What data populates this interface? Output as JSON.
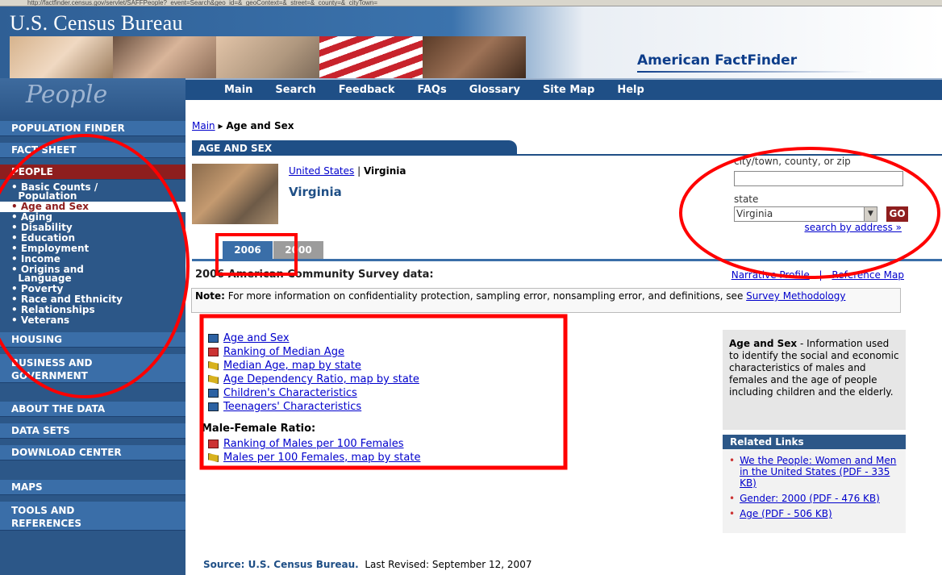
{
  "browser": {
    "address": "http://factfinder.census.gov/servlet/SAFFPeople?_event=Search&geo_id=&_geoContext=&_street=&_county=&_cityTown="
  },
  "header": {
    "title": "U.S. Census Bureau",
    "product": "American FactFinder",
    "people_script": "People"
  },
  "mainnav": [
    "Main",
    "Search",
    "Feedback",
    "FAQs",
    "Glossary",
    "Site Map",
    "Help"
  ],
  "sidebar": {
    "population_finder": "POPULATION FINDER",
    "fact_sheet": "FACT SHEET",
    "people": "PEOPLE",
    "people_items": [
      "• Basic Counts /\n  Population",
      "• Age and Sex",
      "• Aging",
      "• Disability",
      "• Education",
      "• Employment",
      "• Income",
      "• Origins and\n  Language",
      "• Poverty",
      "• Race and Ethnicity",
      "• Relationships",
      "• Veterans"
    ],
    "housing": "HOUSING",
    "business": "BUSINESS AND\nGOVERNMENT",
    "about": "ABOUT THE DATA",
    "data_sets": "DATA SETS",
    "download": "DOWNLOAD CENTER",
    "maps": "MAPS",
    "tools": "TOOLS AND\nREFERENCES"
  },
  "breadcrumb": {
    "main": "Main",
    "sep": "▸",
    "current": "Age and Sex"
  },
  "section_title": "AGE AND SEX",
  "geo": {
    "crumb_link": "United States",
    "crumb_sep": " | ",
    "crumb_current": "Virginia",
    "name": "Virginia"
  },
  "search": {
    "ctzip_label": "city/town, county, or zip",
    "ctzip_value": "",
    "state_label": "state",
    "state_value": "Virginia",
    "go": "GO",
    "by_address": "search by address »"
  },
  "year_tabs": [
    "2006",
    "2000"
  ],
  "acs": {
    "title": "2006 American Community Survey data:",
    "narrative": "Narrative Profile",
    "sep": "|",
    "reference": "Reference Map"
  },
  "note": {
    "label": "Note:",
    "text": " For more information on confidentiality protection, sampling error, nonsampling error, and definitions, see ",
    "link": "Survey Methodology"
  },
  "links": [
    {
      "icon": "table-icon",
      "text": "Age and Sex"
    },
    {
      "icon": "ranking-icon",
      "text": "Ranking of Median Age"
    },
    {
      "icon": "map-icon",
      "text": "Median Age, map by state"
    },
    {
      "icon": "map-icon",
      "text": "Age Dependency Ratio, map by state"
    },
    {
      "icon": "table-icon",
      "text": "Children's Characteristics"
    },
    {
      "icon": "table-icon",
      "text": "Teenagers' Characteristics"
    }
  ],
  "mf_heading": "Male-Female Ratio:",
  "links2": [
    {
      "icon": "ranking-icon",
      "text": "Ranking of Males per 100 Females"
    },
    {
      "icon": "map-icon",
      "text": "Males per 100 Females, map by state"
    }
  ],
  "description": {
    "bold": "Age and Sex",
    "text": " - Information used to identify the social and economic characteristics of males and females and the age of people including children and the elderly."
  },
  "related": {
    "title": "Related Links",
    "items": [
      "We the People: Women and Men in the United States (PDF - 335 KB)",
      "Gender: 2000 (PDF - 476 KB)",
      "Age (PDF - 506 KB)"
    ]
  },
  "source": {
    "label": "Source: U.S. Census Bureau.",
    "revised": "Last Revised: September 12, 2007"
  },
  "colors": {
    "nav_blue": "#1f4f86",
    "active_red": "#8e1e1e",
    "annotation_red": "#ff0000"
  }
}
